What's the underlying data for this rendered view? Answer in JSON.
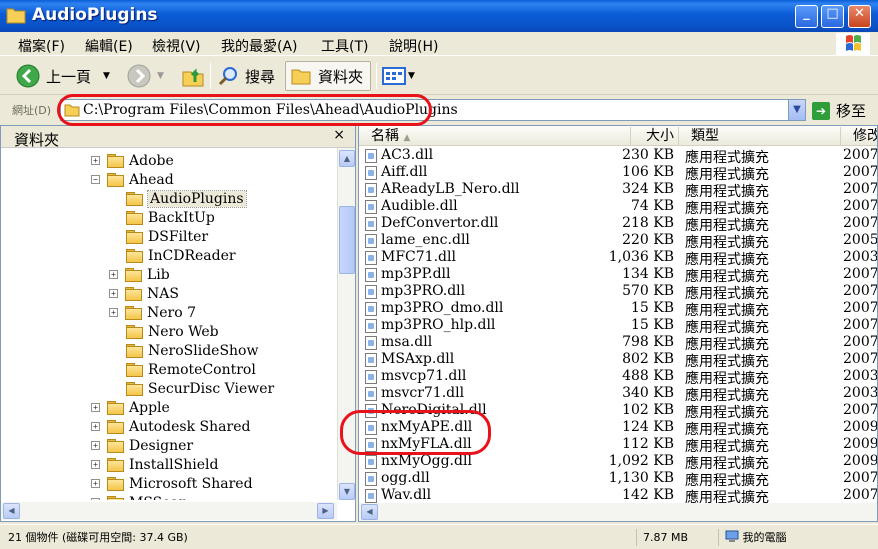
{
  "window": {
    "title": "AudioPlugins",
    "min_btn": "_",
    "max_btn": "□",
    "close_btn": "✕"
  },
  "menu": [
    "檔案(F)",
    "編輯(E)",
    "檢視(V)",
    "我的最愛(A)",
    "工具(T)",
    "說明(H)"
  ],
  "toolbar": {
    "back": "上一頁",
    "search": "搜尋",
    "folders": "資料夾"
  },
  "address": {
    "label": "網址(D)",
    "path": "C:\\Program Files\\Common Files\\Ahead\\AudioPlugins",
    "go": "移至"
  },
  "left_pane": {
    "title": "資料夾",
    "close": "×",
    "tree": [
      {
        "label": "Adobe",
        "level": 0,
        "expander": "+"
      },
      {
        "label": "Ahead",
        "level": 0,
        "expander": "−"
      },
      {
        "label": "AudioPlugins",
        "level": 1,
        "expander": "",
        "selected": true
      },
      {
        "label": "BackItUp",
        "level": 1,
        "expander": ""
      },
      {
        "label": "DSFilter",
        "level": 1,
        "expander": ""
      },
      {
        "label": "InCDReader",
        "level": 1,
        "expander": ""
      },
      {
        "label": "Lib",
        "level": 1,
        "expander": "+"
      },
      {
        "label": "NAS",
        "level": 1,
        "expander": "+"
      },
      {
        "label": "Nero 7",
        "level": 1,
        "expander": "+"
      },
      {
        "label": "Nero Web",
        "level": 1,
        "expander": ""
      },
      {
        "label": "NeroSlideShow",
        "level": 1,
        "expander": ""
      },
      {
        "label": "RemoteControl",
        "level": 1,
        "expander": ""
      },
      {
        "label": "SecurDisc Viewer",
        "level": 1,
        "expander": ""
      },
      {
        "label": "Apple",
        "level": 0,
        "expander": "+"
      },
      {
        "label": "Autodesk Shared",
        "level": 0,
        "expander": "+"
      },
      {
        "label": "Designer",
        "level": 0,
        "expander": "+"
      },
      {
        "label": "InstallShield",
        "level": 0,
        "expander": "+"
      },
      {
        "label": "Microsoft Shared",
        "level": 0,
        "expander": "+"
      },
      {
        "label": "MSSoap",
        "level": 0,
        "expander": "+"
      }
    ]
  },
  "columns": {
    "name": "名稱",
    "size": "大小",
    "type": "類型",
    "modified": "修改"
  },
  "files": [
    {
      "name": "AC3.dll",
      "size": "230 KB",
      "type": "應用程式擴充",
      "date": "2007"
    },
    {
      "name": "Aiff.dll",
      "size": "106 KB",
      "type": "應用程式擴充",
      "date": "2007"
    },
    {
      "name": "AReadyLB_Nero.dll",
      "size": "324 KB",
      "type": "應用程式擴充",
      "date": "2007"
    },
    {
      "name": "Audible.dll",
      "size": "74 KB",
      "type": "應用程式擴充",
      "date": "2007"
    },
    {
      "name": "DefConvertor.dll",
      "size": "218 KB",
      "type": "應用程式擴充",
      "date": "2007"
    },
    {
      "name": "lame_enc.dll",
      "size": "220 KB",
      "type": "應用程式擴充",
      "date": "2005"
    },
    {
      "name": "MFC71.dll",
      "size": "1,036 KB",
      "type": "應用程式擴充",
      "date": "2003"
    },
    {
      "name": "mp3PP.dll",
      "size": "134 KB",
      "type": "應用程式擴充",
      "date": "2007"
    },
    {
      "name": "mp3PRO.dll",
      "size": "570 KB",
      "type": "應用程式擴充",
      "date": "2007"
    },
    {
      "name": "mp3PRO_dmo.dll",
      "size": "15 KB",
      "type": "應用程式擴充",
      "date": "2007"
    },
    {
      "name": "mp3PRO_hlp.dll",
      "size": "15 KB",
      "type": "應用程式擴充",
      "date": "2007"
    },
    {
      "name": "msa.dll",
      "size": "798 KB",
      "type": "應用程式擴充",
      "date": "2007"
    },
    {
      "name": "MSAxp.dll",
      "size": "802 KB",
      "type": "應用程式擴充",
      "date": "2007"
    },
    {
      "name": "msvcp71.dll",
      "size": "488 KB",
      "type": "應用程式擴充",
      "date": "2003"
    },
    {
      "name": "msvcr71.dll",
      "size": "340 KB",
      "type": "應用程式擴充",
      "date": "2003"
    },
    {
      "name": "NeroDigital.dll",
      "size": "102 KB",
      "type": "應用程式擴充",
      "date": "2007"
    },
    {
      "name": "nxMyAPE.dll",
      "size": "124 KB",
      "type": "應用程式擴充",
      "date": "2009"
    },
    {
      "name": "nxMyFLA.dll",
      "size": "112 KB",
      "type": "應用程式擴充",
      "date": "2009"
    },
    {
      "name": "nxMyOgg.dll",
      "size": "1,092 KB",
      "type": "應用程式擴充",
      "date": "2009"
    },
    {
      "name": "ogg.dll",
      "size": "1,130 KB",
      "type": "應用程式擴充",
      "date": "2007"
    },
    {
      "name": "Wav.dll",
      "size": "142 KB",
      "type": "應用程式擴充",
      "date": "2007"
    }
  ],
  "status": {
    "objects": "21 個物件 (磁碟可用空間: 37.4 GB)",
    "size": "7.87 MB",
    "location": "我的電腦"
  },
  "colors": {
    "titlebar": "#0a53c9",
    "highlight_ring": "#e8121a",
    "chrome": "#ece9d8"
  }
}
